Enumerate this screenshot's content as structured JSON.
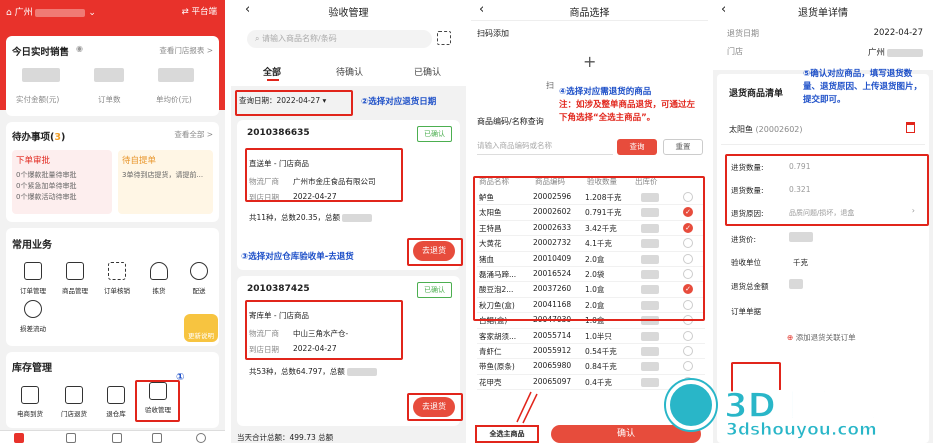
{
  "p1": {
    "store": "广州",
    "platform": "平台端",
    "sales_title": "今日实时销售",
    "store_report": "查看门店报表 >",
    "metrics": [
      "实付金额(元)",
      "订单数",
      "单均价(元)"
    ],
    "todo_title": "待办事项",
    "todo_count": "3",
    "view_all": "查看全部 >",
    "todo1_title": "下单审批",
    "todo1_lines": [
      "0个爆款批量待审批",
      "0个紧急加单待审批",
      "0个爆款活动待审批"
    ],
    "todo2_title": "待自提单",
    "todo2_lines": [
      "3单待到店提货，请提前..."
    ],
    "common_title": "常用业务",
    "common_items": [
      "订单管理",
      "商品管理",
      "订单核销",
      "拣货",
      "配送",
      "损差流动"
    ],
    "badge": "更新说明",
    "stock_title": "库存管理",
    "stock_items": [
      "电商到货",
      "门店退货",
      "退仓库",
      "验收管理"
    ],
    "marker": "①"
  },
  "p2": {
    "title": "验收管理",
    "search_placeholder": "请输入商品名称/条码",
    "tabs": [
      "全部",
      "待确认",
      "已确认"
    ],
    "date_label": "查询日期：",
    "date_value": "2022-04-27",
    "step2": "②选择对应退货日期",
    "step3": "③选择对应仓库验收单-去退货",
    "orders": [
      {
        "id": "2010386635",
        "status": "已确认",
        "type": "直送单 - 门店商品",
        "vendor_label": "物流厂商",
        "vendor": "广州市金庄食品有限公司",
        "date_label": "到店日期",
        "date": "2022-04-27",
        "summary": "共11种，总数20.35，总额",
        "button": "去退货"
      },
      {
        "id": "2010387425",
        "status": "已确认",
        "type": "寄库单 - 门店商品",
        "vendor_label": "物流厂商",
        "vendor": "中山三角水产仓-",
        "date_label": "到店日期",
        "date": "2022-04-27",
        "summary": "共53种，总数64.797，总额",
        "button": "去退货"
      }
    ],
    "footer": "当天合计总额：499.73 总额"
  },
  "p3": {
    "title": "商品选择",
    "scan_label": "扫码添加",
    "scan_side": "扫",
    "search_label": "商品编码/名称查询",
    "search_placeholder": "请输入商品编码或名称",
    "query_btn": "查询",
    "reset_btn": "重置",
    "step4_title": "④选择对应需退货的商品",
    "step4_note": "注：如涉及整单商品退货，可通过左下角选择“全选主商品”。",
    "columns": [
      "商品名称",
      "商品编码",
      "验收数量",
      "出库价"
    ],
    "rows": [
      {
        "name": "鲈鱼",
        "code": "20002596",
        "qty": "1.208千克",
        "checked": false
      },
      {
        "name": "太阳鱼",
        "code": "20002602",
        "qty": "0.791千克",
        "checked": true
      },
      {
        "name": "王特昌",
        "code": "20002633",
        "qty": "3.42千克",
        "checked": true
      },
      {
        "name": "大黄花",
        "code": "20002732",
        "qty": "4.1千克",
        "checked": false
      },
      {
        "name": "猪血",
        "code": "20010409",
        "qty": "2.0盒",
        "checked": false
      },
      {
        "name": "磊涌马蹄...",
        "code": "20016524",
        "qty": "2.0袋",
        "checked": false
      },
      {
        "name": "酸豆泡2...",
        "code": "20037260",
        "qty": "1.0盒",
        "checked": true
      },
      {
        "name": "秋刀鱼(盒)",
        "code": "20041168",
        "qty": "2.0盒",
        "checked": false
      },
      {
        "name": "白鲳(盒)",
        "code": "20047030",
        "qty": "1.0盒",
        "checked": false
      },
      {
        "name": "客家胡须...",
        "code": "20055714",
        "qty": "1.0半只",
        "checked": false
      },
      {
        "name": "青虾仁",
        "code": "20055912",
        "qty": "0.54千克",
        "checked": false
      },
      {
        "name": "带鱼(原条)",
        "code": "20065980",
        "qty": "0.84千克",
        "checked": false
      },
      {
        "name": "花甲壳",
        "code": "20065097",
        "qty": "0.4千克",
        "checked": false
      }
    ],
    "select_all": "全选主商品",
    "confirm": "确认"
  },
  "p4": {
    "title": "退货单详情",
    "date_label": "退货日期",
    "date": "2022-04-27",
    "store_label": "门店",
    "store": "广州",
    "list_label": "退货商品清单",
    "step5": "⑤确认对应商品，填写退货数量、退货原因、上传退货图片，提交即可。",
    "item": "太阳鱼",
    "item_code": "(20002602)",
    "received_label": "进货数量:",
    "received": "0.791",
    "return_label": "退货数量:",
    "return_qty": "0.321",
    "reason_label": "退货原因:",
    "reason": "品质问题/损坏，退盒",
    "price_label": "进货价:",
    "unit_label": "验收单位",
    "unit": "千克",
    "total_label": "退货总金额",
    "order_label": "订单单据",
    "add_order": "添加退货关联订单",
    "watermark_title": "3D手游网",
    "watermark_url": "3dshouyou.com"
  }
}
